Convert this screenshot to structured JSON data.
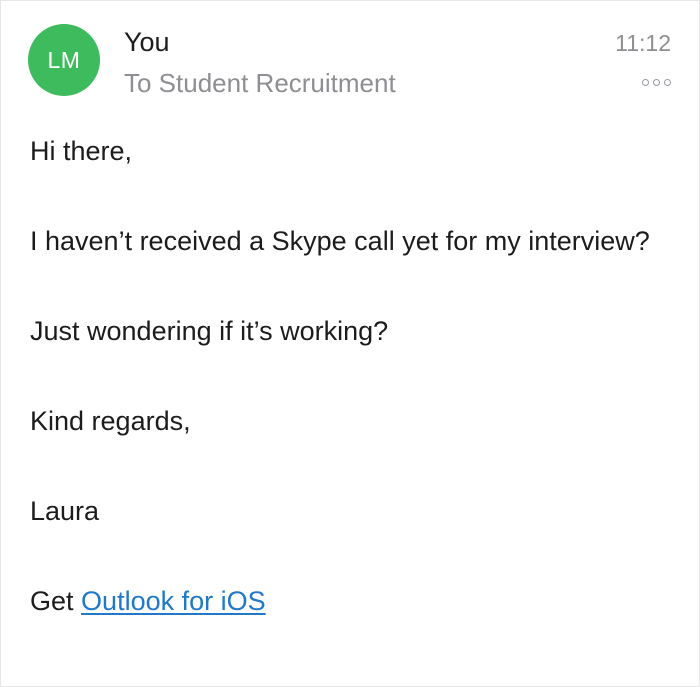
{
  "header": {
    "avatar_initials": "LM",
    "avatar_color": "#3dbb5d",
    "sender": "You",
    "recipient": "To Student Recruitment",
    "time": "11:12",
    "more_icon": "ellipsis-icon"
  },
  "message": {
    "greeting": "Hi there,",
    "paragraph_1": "I haven’t received a Skype call yet for my interview?",
    "paragraph_2": "Just wondering if it’s working?",
    "closing": "Kind regards,",
    "signature": "Laura",
    "footer_prefix": "Get",
    "footer_link": "Outlook for iOS",
    "link_color": "#1f78c8"
  }
}
